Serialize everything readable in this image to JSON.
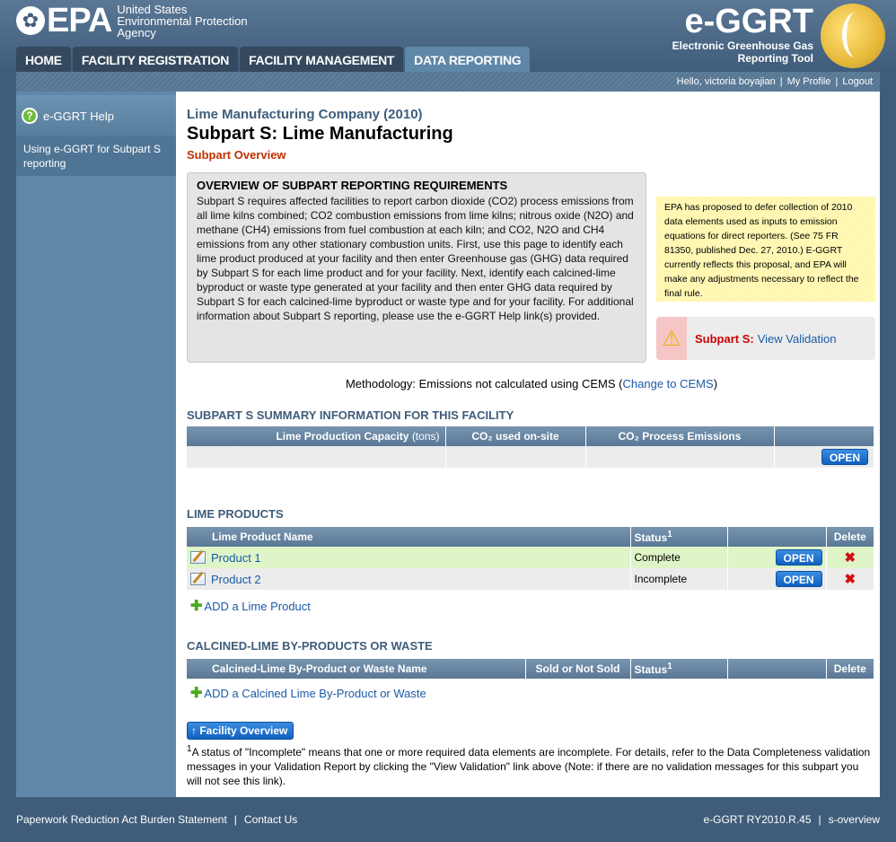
{
  "header": {
    "epa_text": "EPA",
    "agency_line1": "United States",
    "agency_line2": "Environmental Protection",
    "agency_line3": "Agency",
    "app_title": "e-GGRT",
    "app_sub1": "Electronic Greenhouse Gas",
    "app_sub2": "Reporting Tool"
  },
  "tabs": [
    {
      "label": "HOME"
    },
    {
      "label": "FACILITY REGISTRATION"
    },
    {
      "label": "FACILITY MANAGEMENT"
    },
    {
      "label": "DATA REPORTING"
    }
  ],
  "userbar": {
    "greeting": "Hello, victoria boyajian",
    "profile": "My Profile",
    "logout": "Logout"
  },
  "sidebar": {
    "help_label": "e-GGRT Help",
    "link": "Using e-GGRT for Subpart S reporting"
  },
  "main": {
    "company": "Lime Manufacturing Company (2010)",
    "title": "Subpart S: Lime Manufacturing",
    "subtitle": "Subpart Overview"
  },
  "overview": {
    "heading": "OVERVIEW OF SUBPART REPORTING REQUIREMENTS",
    "body": "Subpart S requires affected facilities to report carbon dioxide (CO2) process emissions from all lime kilns combined; CO2 combustion emissions from lime kilns; nitrous oxide (N2O) and methane (CH4) emissions from fuel combustion at each kiln; and CO2, N2O and CH4 emissions from any other stationary combustion units. First, use this page to identify each lime product produced at your facility and then enter Greenhouse gas (GHG) data required by Subpart S for each lime product and for your facility. Next, identify each calcined-lime byproduct or waste type generated at your facility and then enter GHG data required by Subpart S for each calcined-lime byproduct or waste type and for your facility. For additional information about Subpart S reporting, please use the e-GGRT Help link(s) provided."
  },
  "note": "EPA has proposed to defer collection of 2010 data elements used as inputs to emission equations for direct reporters. (See 75 FR 81350, published Dec. 27, 2010.) E-GGRT currently reflects this proposal, and EPA will make any adjustments necessary to reflect the final rule.",
  "validation": {
    "label": "Subpart S:",
    "link": "View Validation"
  },
  "methodology": {
    "prefix": "Methodology: Emissions not calculated using CEMS (",
    "link": "Change to CEMS",
    "suffix": ")"
  },
  "summary": {
    "title": "SUBPART S SUMMARY INFORMATION FOR THIS FACILITY",
    "col1": "Lime Production Capacity",
    "col1_unit": "(tons)",
    "col2": "CO₂ used on-site",
    "col3": "CO₂ Process Emissions",
    "open": "OPEN"
  },
  "lime_products": {
    "title": "LIME PRODUCTS",
    "col_name": "Lime Product Name",
    "col_status": "Status",
    "col_status_sup": "1",
    "col_delete": "Delete",
    "rows": [
      {
        "name": "Product 1",
        "status": "Complete",
        "open": "OPEN"
      },
      {
        "name": "Product 2",
        "status": "Incomplete",
        "open": "OPEN"
      }
    ],
    "add": "ADD a Lime Product"
  },
  "byproducts": {
    "title": "CALCINED-LIME BY-PRODUCTS OR WASTE",
    "col_name": "Calcined-Lime By-Product or Waste Name",
    "col_sold": "Sold or Not Sold",
    "col_status": "Status",
    "col_status_sup": "1",
    "col_delete": "Delete",
    "add": "ADD a Calcined Lime By-Product or Waste"
  },
  "facility_overview_btn": "Facility Overview",
  "footnote": {
    "sup": "1",
    "text": "A status of \"Incomplete\" means that one or more required data elements are incomplete. For details, refer to the Data Completeness validation messages in your Validation Report by clicking the \"View Validation\" link above (Note: if there are no validation messages for this subpart you will not see this link)."
  },
  "footer": {
    "burden": "Paperwork Reduction Act Burden Statement",
    "contact": "Contact Us",
    "version": "e-GGRT RY2010.R.45",
    "page": "s-overview"
  }
}
